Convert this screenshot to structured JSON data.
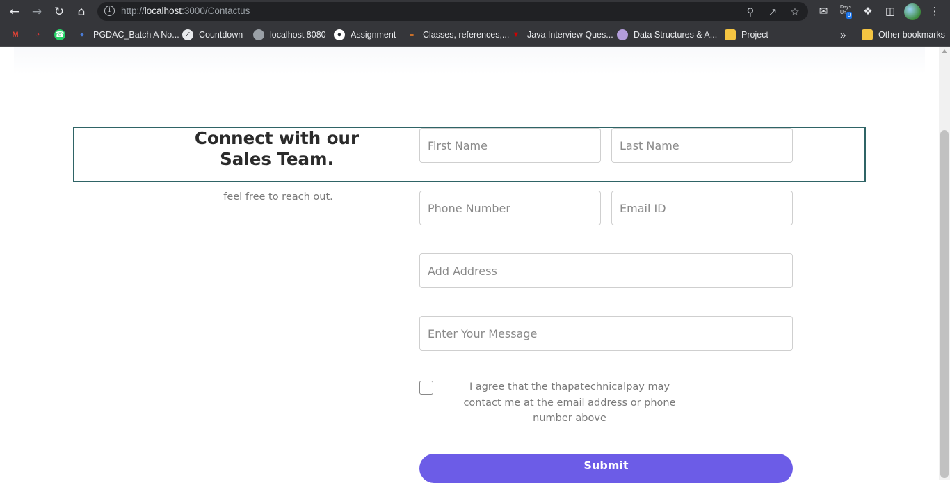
{
  "browser": {
    "url_prefix": "http://",
    "url_host": "localhost",
    "url_rest": ":3000/Contactus",
    "days_ext_label": "Days\nUn",
    "days_ext_badge": "9"
  },
  "bookmarks": {
    "items": [
      {
        "label": "PGDAC_Batch A No...",
        "icon": "people-icon",
        "color": "#4a7bd6"
      },
      {
        "label": "Countdown",
        "icon": "check-circle-icon",
        "color": "#e8eaed"
      },
      {
        "label": "localhost 8080",
        "icon": "globe-icon",
        "color": "#9aa0a6"
      },
      {
        "label": "Assignment",
        "icon": "github-icon",
        "color": "#ffffff"
      },
      {
        "label": "Classes, references,...",
        "icon": "stackoverflow-icon",
        "color": "#f48024"
      },
      {
        "label": "Java Interview Ques...",
        "icon": "v-logo-icon",
        "color": "#d50000"
      },
      {
        "label": "Data Structures & A...",
        "icon": "avatar-icon",
        "color": "#b39ddb"
      },
      {
        "label": "Project",
        "icon": "folder-icon",
        "color": "#f5c542"
      }
    ],
    "overflow": "»",
    "other": "Other bookmarks"
  },
  "contact": {
    "heading_line1": "Connect with our",
    "heading_line2": "Sales Team.",
    "subtext": "feel free to reach out.",
    "first_name_placeholder": "First Name",
    "last_name_placeholder": "Last Name",
    "phone_placeholder": "Phone Number",
    "email_placeholder": "Email ID",
    "address_placeholder": "Add Address",
    "message_placeholder": "Enter Your Message",
    "agree_text": "I agree that the thapatechnicalpay may contact me at the email address or phone number above",
    "submit_label": "Submit",
    "accent_color": "#6c5ce7"
  }
}
